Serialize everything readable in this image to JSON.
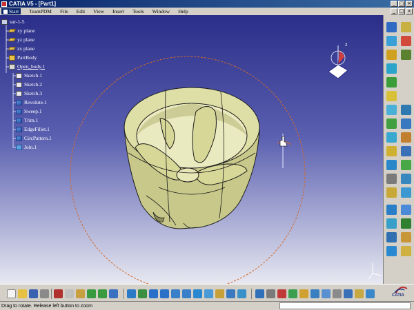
{
  "window": {
    "title": "CATIA V5 - [Part1]"
  },
  "menu": {
    "start": "Start",
    "items": [
      "TeamPDM",
      "File",
      "Edit",
      "View",
      "Insert",
      "Tools",
      "Window",
      "Help"
    ]
  },
  "tree": {
    "root": "sur-1-5",
    "items": [
      {
        "label": "xy plane",
        "icon": "plane-icon"
      },
      {
        "label": "yz plane",
        "icon": "plane-icon"
      },
      {
        "label": "zx plane",
        "icon": "plane-icon"
      },
      {
        "label": "PartBody",
        "icon": "partbody-icon"
      },
      {
        "label": "Open_body.1",
        "icon": "open-body-icon"
      },
      {
        "label": "Sketch.1",
        "icon": "sketch-icon"
      },
      {
        "label": "Sketch.2",
        "icon": "sketch-icon"
      },
      {
        "label": "Sketch.3",
        "icon": "sketch-icon"
      },
      {
        "label": "Revolute.1",
        "icon": "revolute-icon"
      },
      {
        "label": "Sweep.1",
        "icon": "sweep-icon"
      },
      {
        "label": "Trim.1",
        "icon": "trim-icon"
      },
      {
        "label": "EdgeFillet.1",
        "icon": "edge-fillet-icon"
      },
      {
        "label": "CircPattern.1",
        "icon": "circ-pattern-icon"
      },
      {
        "label": "Join.1",
        "icon": "join-icon"
      }
    ]
  },
  "compass": {
    "axis_label": "z"
  },
  "status": {
    "text": "Drag to rotate. Release left button to zoom",
    "command_value": ""
  },
  "logo": {
    "text": "CATIA"
  },
  "colors": {
    "part": "#d8d99a",
    "viewport_top": "#2b2e88",
    "rotation_circle": "#d46a2a",
    "selection": "#0a246a"
  }
}
